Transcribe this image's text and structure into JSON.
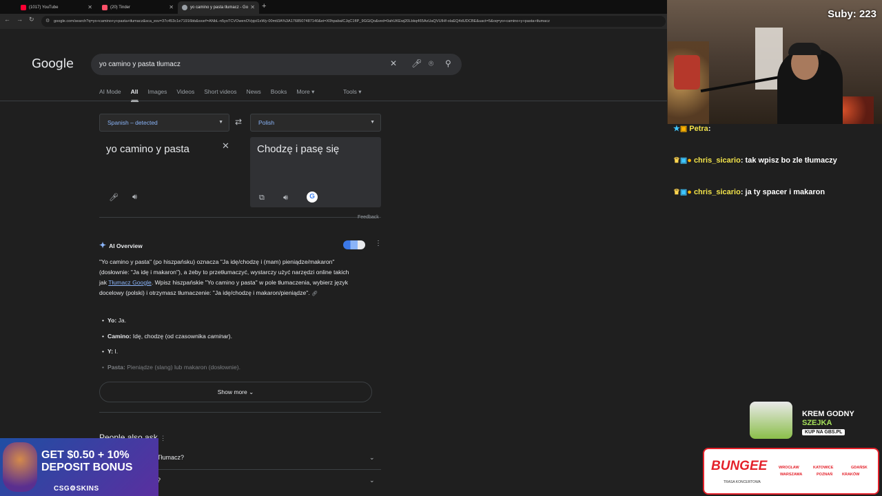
{
  "browser": {
    "tabs": [
      {
        "title": "(1017) YouTube",
        "color": "#ff0033"
      },
      {
        "title": "(20) Tinder",
        "color": "#fd5068"
      },
      {
        "title": "yo camino y pasta tłumacz - Go",
        "color": "#9aa0a6"
      }
    ],
    "new_tab": "+",
    "url": "google.com/search?q=yo+camino+y+pasta+tłumacz&sca_esv=37c453c1e71916bb&sxsrf=ANbL-n5yoTCVOwenOVpjol1xWy-00mti3A%3A1768507487140&ei=X0hpabaICJqC1fIP_9GGiQo&ved=0ahUKEwj20Lbkq465AxUaQVUIHf-oIaEQ4dUDCBE&uact=5&oq=yo+camino+y+pasta+tłumacz"
  },
  "google": {
    "logo": "Google",
    "query": "yo camino y pasta tłumacz",
    "tabs": [
      "AI Mode",
      "All",
      "Images",
      "Videos",
      "Short videos",
      "News",
      "Books",
      "More ▾"
    ],
    "tools": "Tools ▾",
    "translate": {
      "source_lang": "Spanish – detected",
      "target_lang": "Polish",
      "source_text": "yo camino y pasta",
      "target_text": "Chodzę i pasę się",
      "feedback": "Feedback"
    },
    "ai_overview": {
      "title": "AI Overview",
      "body_1": "\"Yo camino y pasta\" (po hiszpańsku) oznacza \"Ja idę/chodzę i (mam) pieniądze/makaron\" (dosłownie: \"Ja idę i makaron\"), a żeby to przetłumaczyć, wystarczy użyć narzędzi online takich jak ",
      "link": "Tłumacz Google",
      "body_2": ". Wpisz hiszpańskie \"Yo camino y pasta\" w pole tłumaczenia, wybierz język docelowy (polski) i otrzymasz tłumaczenie: \"Ja idę/chodzę i makaron/pieniądze\".",
      "bullets": [
        {
          "term": "Yo:",
          "def": " Ja."
        },
        {
          "term": "Camino:",
          "def": " Idę, chodzę (od czasownika ",
          "em": "caminar",
          "tail": ")."
        },
        {
          "term": "Y:",
          "def": " I."
        },
        {
          "term": "Pasta:",
          "def": " Pieniądze (slang) lub makaron (dosłownie)."
        }
      ],
      "show_more": "Show more"
    },
    "people_also_ask": {
      "title": "People also ask",
      "rows": [
        "Tłumacz?",
        "?"
      ]
    }
  },
  "stream": {
    "subs_label": "Suby: 223",
    "chat": [
      {
        "user": "Petra",
        "msg": ""
      },
      {
        "user": "chris_sicario",
        "msg": "tak wpisz bo zle tłumaczy"
      },
      {
        "user": "chris_sicario",
        "msg": "ja ty spacer i makaron"
      }
    ],
    "ads": {
      "csgo_line1": "GET $0.50 + 10%",
      "csgo_line2": "DEPOSIT BONUS",
      "csgo_brand": "CSG⚙SKINS",
      "gbs_line1": "KREM GODNY",
      "gbs_line2": "SZEJKA",
      "gbs_cta": "KUP NA GBS.PL",
      "bungee_logo": "BUNGEE",
      "bungee_sub": "TRASA KONCERTOWA",
      "bungee_cities": [
        "WROCŁAW",
        "KATOWICE",
        "GDAŃSK",
        "WARSZAWA",
        "POZNAŃ",
        "KRAKÓW"
      ]
    }
  }
}
